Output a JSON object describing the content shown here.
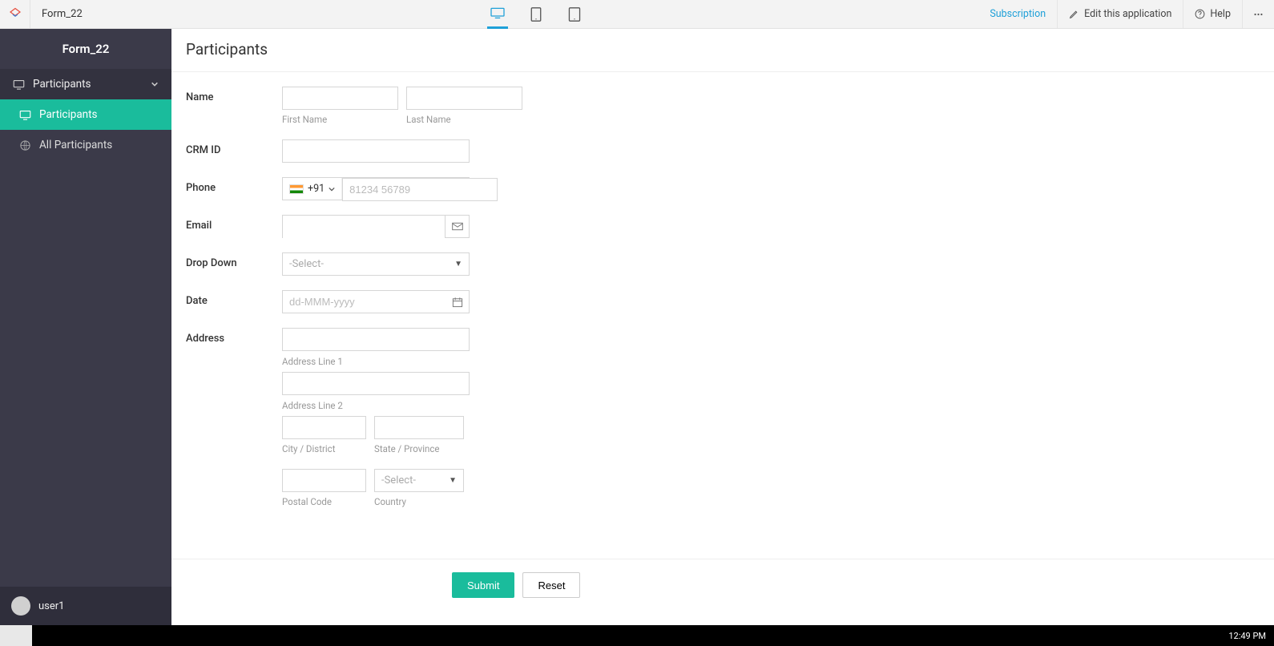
{
  "topbar": {
    "app_title": "Form_22",
    "subscription": "Subscription",
    "edit_app": "Edit this application",
    "help": "Help"
  },
  "sidebar": {
    "title": "Form_22",
    "section_label": "Participants",
    "items": [
      {
        "label": "Participants"
      },
      {
        "label": "All Participants"
      }
    ],
    "user": "user1"
  },
  "page": {
    "title": "Participants",
    "labels": {
      "name": "Name",
      "first_name": "First Name",
      "last_name": "Last Name",
      "crm_id": "CRM ID",
      "phone": "Phone",
      "email": "Email",
      "dropdown": "Drop Down",
      "date": "Date",
      "address": "Address",
      "addr1": "Address Line 1",
      "addr2": "Address Line 2",
      "city": "City / District",
      "state": "State / Province",
      "postal": "Postal Code",
      "country": "Country"
    },
    "phone_cc": "+91",
    "phone_placeholder": "81234 56789",
    "select_placeholder": "-Select-",
    "date_placeholder": "dd-MMM-yyyy",
    "buttons": {
      "submit": "Submit",
      "reset": "Reset"
    }
  },
  "taskbar": {
    "time": "12:49 PM"
  }
}
